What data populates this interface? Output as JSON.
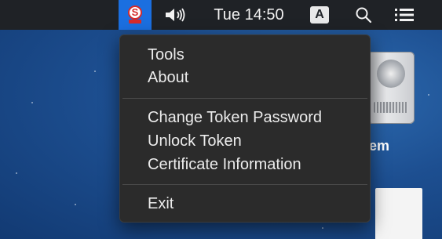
{
  "menubar": {
    "clock": "Tue 14:50",
    "input_badge": "A",
    "icons": [
      "token-app-icon",
      "volume-icon",
      "search-icon",
      "list-icon"
    ]
  },
  "menu": {
    "items": [
      {
        "label": "Tools"
      },
      {
        "label": "About"
      },
      {
        "label": "Change Token Password"
      },
      {
        "label": "Unlock Token"
      },
      {
        "label": "Certificate Information"
      },
      {
        "label": "Exit"
      }
    ]
  },
  "desktop": {
    "drive_label_partial": "em"
  },
  "colors": {
    "menubar_bg": "#1f2226",
    "menu_bg": "#2b2b2b",
    "highlight_blue": "#1b6fe0",
    "app_red": "#d62b2b"
  }
}
